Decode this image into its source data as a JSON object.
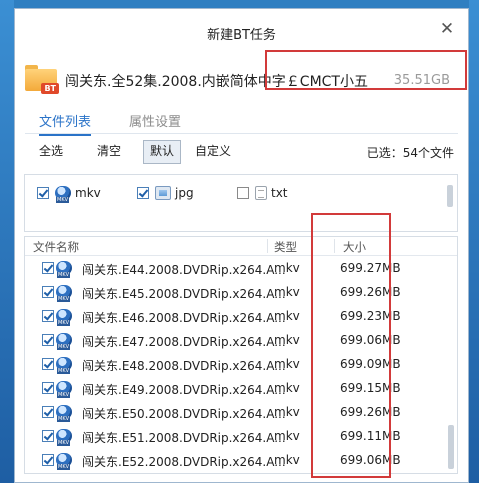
{
  "window": {
    "title": "新建BT任务"
  },
  "task": {
    "name": "闯关东.全52集.2008.内嵌简体中字￡CMCT小五",
    "size": "35.51GB",
    "badge": "BT"
  },
  "tabs": [
    {
      "label": "文件列表"
    },
    {
      "label": "属性设置"
    }
  ],
  "toolbar": {
    "select_all": "全选",
    "clear": "清空",
    "default": "默认",
    "custom": "自定义",
    "selected_count": "已选：54个文件"
  },
  "filters": [
    {
      "checked": true,
      "icon": "mkv-icon",
      "label": "mkv"
    },
    {
      "checked": true,
      "icon": "jpg-icon",
      "label": "jpg"
    },
    {
      "checked": false,
      "icon": "txt-icon",
      "label": "txt"
    }
  ],
  "table": {
    "headers": {
      "name": "文件名称",
      "type": "类型",
      "size": "大小"
    },
    "rows": [
      {
        "name": "闯关东.E44.2008.DVDRip.x264.A...",
        "type": "mkv",
        "size": "699.27MB"
      },
      {
        "name": "闯关东.E45.2008.DVDRip.x264.A...",
        "type": "mkv",
        "size": "699.26MB"
      },
      {
        "name": "闯关东.E46.2008.DVDRip.x264.A...",
        "type": "mkv",
        "size": "699.23MB"
      },
      {
        "name": "闯关东.E47.2008.DVDRip.x264.A...",
        "type": "mkv",
        "size": "699.06MB"
      },
      {
        "name": "闯关东.E48.2008.DVDRip.x264.A...",
        "type": "mkv",
        "size": "699.09MB"
      },
      {
        "name": "闯关东.E49.2008.DVDRip.x264.A...",
        "type": "mkv",
        "size": "699.15MB"
      },
      {
        "name": "闯关东.E50.2008.DVDRip.x264.A...",
        "type": "mkv",
        "size": "699.26MB"
      },
      {
        "name": "闯关东.E51.2008.DVDRip.x264.A...",
        "type": "mkv",
        "size": "699.11MB"
      },
      {
        "name": "闯关东.E52.2008.DVDRip.x264.A...",
        "type": "mkv",
        "size": "699.06MB"
      }
    ]
  },
  "colors": {
    "accent": "#2a73c8",
    "highlight_box": "#d23a3a"
  }
}
